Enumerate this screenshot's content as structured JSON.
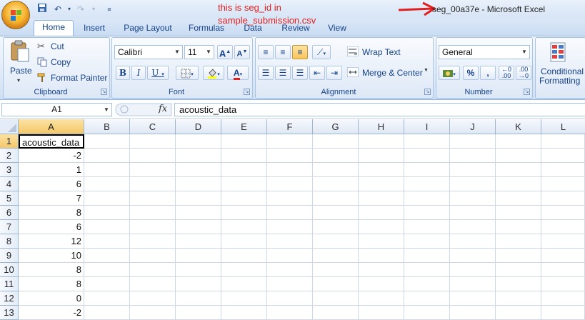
{
  "window": {
    "title": "seg_00a37e - Microsoft Excel"
  },
  "annotation": {
    "line1": "this is seg_id in",
    "line2": "sample_submission.csv",
    "color": "#e02020"
  },
  "ribbon_tabs": [
    "Home",
    "Insert",
    "Page Layout",
    "Formulas",
    "Data",
    "Review",
    "View"
  ],
  "clipboard": {
    "paste": "Paste",
    "cut": "Cut",
    "copy": "Copy",
    "format_painter": "Format Painter",
    "label": "Clipboard"
  },
  "font": {
    "name": "Calibri",
    "size": "11",
    "label": "Font"
  },
  "alignment": {
    "wrap_text": "Wrap Text",
    "merge_center": "Merge & Center",
    "label": "Alignment"
  },
  "number": {
    "format": "General",
    "label": "Number"
  },
  "styles": {
    "conditional_formatting_l1": "Conditional",
    "conditional_formatting_l2": "Formatting"
  },
  "formula_bar": {
    "name_box": "A1",
    "fx": "fx",
    "content": "acoustic_data"
  },
  "sheet": {
    "columns": [
      "A",
      "B",
      "C",
      "D",
      "E",
      "F",
      "G",
      "H",
      "I",
      "J",
      "K",
      "L"
    ],
    "rows": [
      {
        "n": "1",
        "a": "acoustic_data"
      },
      {
        "n": "2",
        "a": "-2"
      },
      {
        "n": "3",
        "a": "1"
      },
      {
        "n": "4",
        "a": "6"
      },
      {
        "n": "5",
        "a": "7"
      },
      {
        "n": "6",
        "a": "8"
      },
      {
        "n": "7",
        "a": "6"
      },
      {
        "n": "8",
        "a": "12"
      },
      {
        "n": "9",
        "a": "10"
      },
      {
        "n": "10",
        "a": "8"
      },
      {
        "n": "11",
        "a": "8"
      },
      {
        "n": "12",
        "a": "0"
      },
      {
        "n": "13",
        "a": "-2"
      }
    ]
  }
}
